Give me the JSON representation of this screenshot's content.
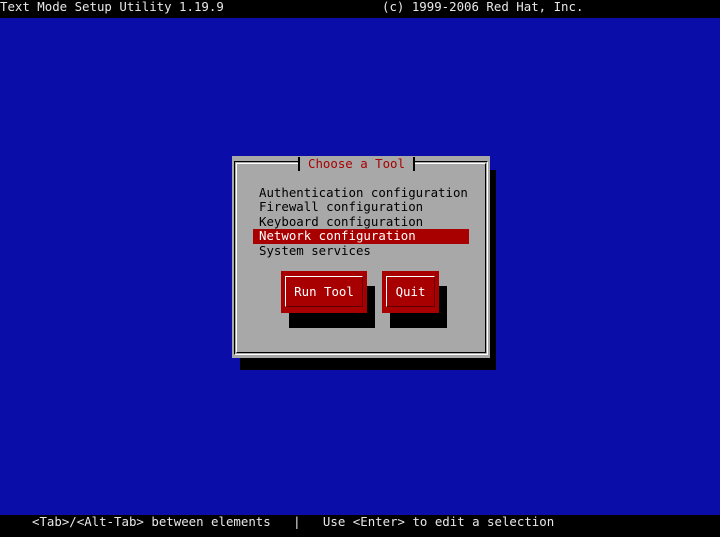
{
  "header": {
    "title": "Text Mode Setup Utility 1.19.9",
    "copyright": "(c) 1999-2006 Red Hat, Inc."
  },
  "dialog": {
    "title": "Choose a Tool",
    "items": [
      {
        "label": "Authentication configuration"
      },
      {
        "label": "Firewall configuration"
      },
      {
        "label": "Keyboard configuration"
      },
      {
        "label": "Network configuration"
      },
      {
        "label": "System services"
      }
    ],
    "selected_index": 3,
    "buttons": {
      "run": "Run Tool",
      "quit": "Quit"
    }
  },
  "footer": {
    "help": "<Tab>/<Alt-Tab> between elements   |   Use <Enter> to edit a selection"
  },
  "colors": {
    "background": "#0a0da8",
    "dialog": "#a8a8a8",
    "accent": "#a80000"
  }
}
